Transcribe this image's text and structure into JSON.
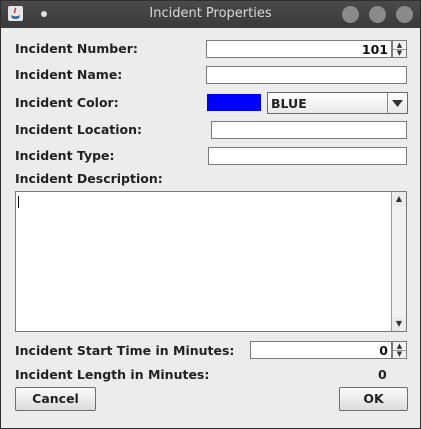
{
  "window": {
    "title": "Incident Properties"
  },
  "labels": {
    "number": "Incident Number:",
    "name": "Incident Name:",
    "color": "Incident Color:",
    "location": "Incident Location:",
    "type": "Incident Type:",
    "description": "Incident Description:",
    "start_time": "Incident Start Time in Minutes:",
    "length": "Incident Length in Minutes:"
  },
  "fields": {
    "number": "101",
    "name": "",
    "location": "",
    "type": "",
    "description": "",
    "start_time": "0",
    "length": "0"
  },
  "color": {
    "selected": "BLUE",
    "swatch": "#0000ff"
  },
  "buttons": {
    "cancel": "Cancel",
    "ok": "OK"
  },
  "icons": [
    "java-app-icon",
    "menu-dot-icon",
    "window-control-icons",
    "spinner-arrow-icons",
    "dropdown-arrow-icon",
    "scroll-arrow-icons"
  ]
}
